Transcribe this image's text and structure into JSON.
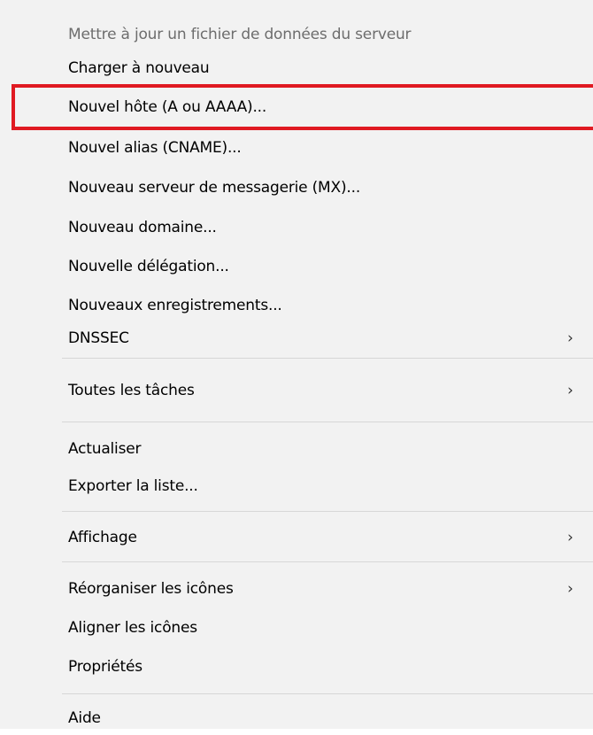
{
  "context_menu": {
    "items": [
      {
        "label": "Mettre à jour un fichier de données du serveur",
        "enabled": false
      },
      {
        "label": "Charger à nouveau"
      },
      {
        "label": "Nouvel hôte (A ou AAAA)...",
        "highlighted": true
      },
      {
        "label": "Nouvel alias (CNAME)..."
      },
      {
        "label": "Nouveau serveur de messagerie (MX)..."
      },
      {
        "label": "Nouveau domaine..."
      },
      {
        "label": "Nouvelle délégation..."
      },
      {
        "label": "Nouveaux enregistrements..."
      },
      {
        "label": "DNSSEC",
        "has_submenu": true
      },
      {
        "label": "Toutes les tâches",
        "has_submenu": true
      },
      {
        "label": "Actualiser"
      },
      {
        "label": "Exporter la liste..."
      },
      {
        "label": "Affichage",
        "has_submenu": true
      },
      {
        "label": "Réorganiser les icônes",
        "has_submenu": true
      },
      {
        "label": "Aligner les icônes"
      },
      {
        "label": "Propriétés"
      },
      {
        "label": "Aide"
      }
    ],
    "submenu_arrow_glyph": "›",
    "highlight_color": "#e01a22"
  }
}
